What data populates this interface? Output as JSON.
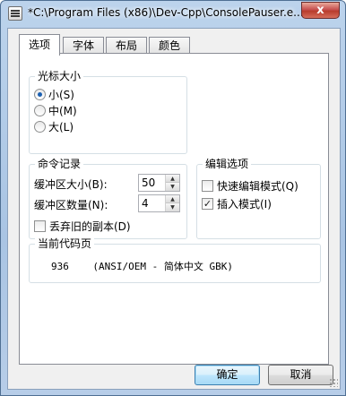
{
  "window": {
    "title": "*C:\\Program Files (x86)\\Dev-Cpp\\ConsolePauser.e..."
  },
  "titlebar": {
    "close_label": "x"
  },
  "tabs": [
    {
      "label": "选项",
      "active": true
    },
    {
      "label": "字体",
      "active": false
    },
    {
      "label": "布局",
      "active": false
    },
    {
      "label": "颜色",
      "active": false
    }
  ],
  "cursor_size": {
    "title": "光标大小",
    "options": [
      {
        "label": "小(S)",
        "selected": true
      },
      {
        "label": "中(M)",
        "selected": false
      },
      {
        "label": "大(L)",
        "selected": false
      }
    ]
  },
  "command_history": {
    "title": "命令记录",
    "buffer_size_label": "缓冲区大小(B):",
    "buffer_size_value": "50",
    "buffer_count_label": "缓冲区数量(N):",
    "buffer_count_value": "4",
    "discard_label": "丢弃旧的副本(D)",
    "discard_checked": false
  },
  "edit_options": {
    "title": "编辑选项",
    "quick_edit_label": "快速编辑模式(Q)",
    "quick_edit_checked": false,
    "insert_mode_label": "插入模式(I)",
    "insert_mode_checked": true
  },
  "code_page": {
    "title": "当前代码页",
    "value": "936    (ANSI/OEM - 简体中文 GBK)"
  },
  "buttons": {
    "ok": "确定",
    "cancel": "取消"
  },
  "icons": [
    "app-console-icon",
    "close-icon",
    "spin-up-icon",
    "spin-down-icon",
    "checkmark-icon",
    "radio-dot-icon"
  ],
  "colors": {
    "frame": "#bcd3ec",
    "close": "#c75050",
    "selection": "#1b5fb1"
  }
}
